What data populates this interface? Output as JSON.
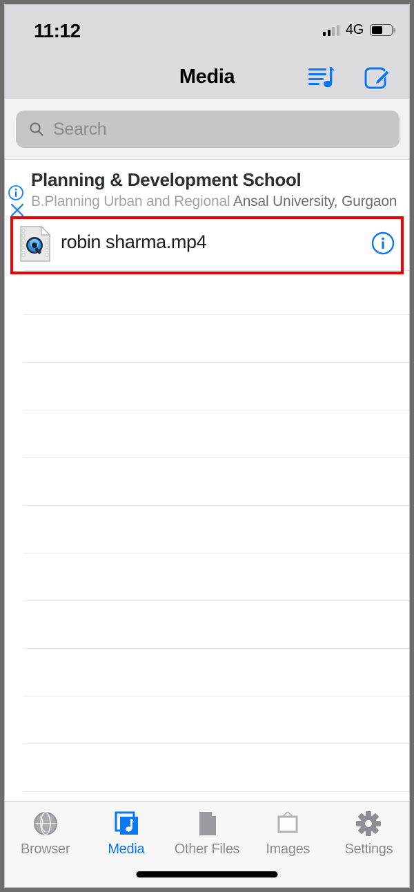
{
  "status_bar": {
    "time": "11:12",
    "network_label": "4G",
    "signal_bars_filled": 2,
    "signal_bars_total": 4,
    "battery_percent": 55
  },
  "nav_bar": {
    "title": "Media",
    "playlist_icon": "music-list-icon",
    "compose_icon": "compose-icon",
    "accent_color": "#0a78f5"
  },
  "search": {
    "placeholder": "Search",
    "value": "",
    "icon": "search-icon"
  },
  "list_header": {
    "title": "Planning & Development School",
    "subtitle_light": "B.Planning Urban and Regional",
    "subtitle_dark": "Ansal University, Gurgaon",
    "info_icon": "info-circle-icon",
    "close_icon": "close-x-icon"
  },
  "file_row": {
    "name": "robin sharma.mp4",
    "file_icon": "quicktime-movie-file-icon",
    "info_icon": "info-circle-icon",
    "highlight_color": "#ee0000",
    "highlighted": true
  },
  "empty_rows": [
    1,
    2,
    3,
    4,
    5,
    6,
    7,
    8,
    9,
    10,
    11
  ],
  "tab_bar": {
    "active_index": 1,
    "items": [
      {
        "label": "Browser",
        "icon": "globe-icon"
      },
      {
        "label": "Media",
        "icon": "media-music-icon"
      },
      {
        "label": "Other Files",
        "icon": "document-icon"
      },
      {
        "label": "Images",
        "icon": "picture-frame-icon"
      },
      {
        "label": "Settings",
        "icon": "gear-icon"
      }
    ]
  },
  "home_indicator": "home-indicator-bar"
}
